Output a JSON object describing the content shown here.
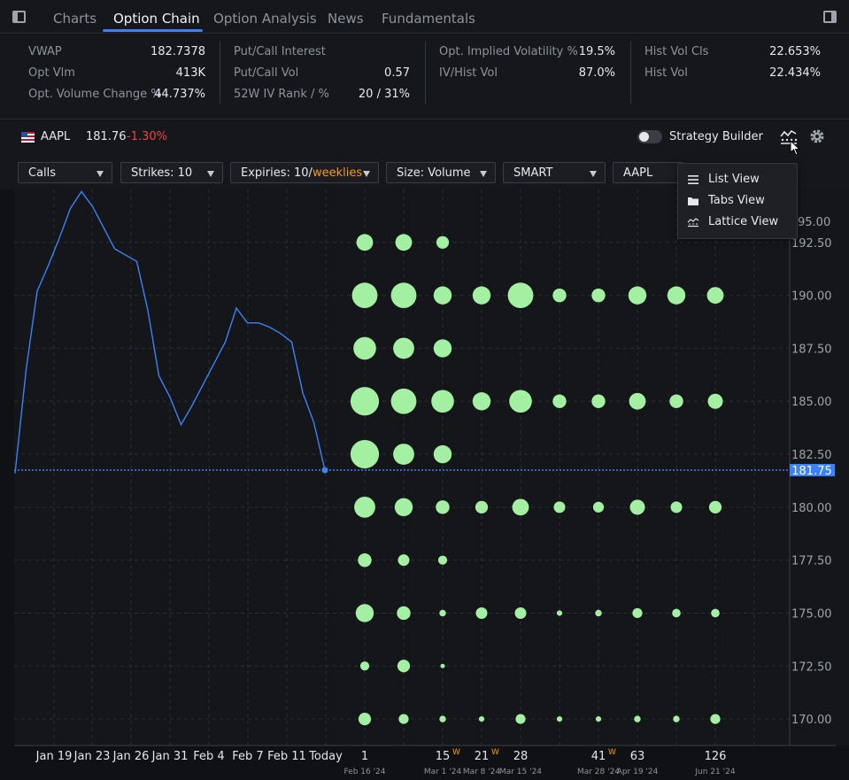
{
  "tabs": [
    {
      "label": "Charts"
    },
    {
      "label": "Option Chain"
    },
    {
      "label": "Option Analysis"
    },
    {
      "label": "News"
    },
    {
      "label": "Fundamentals"
    }
  ],
  "active_tab": "Option Chain",
  "stats": [
    [
      {
        "label": "VWAP",
        "value": "182.7378"
      },
      {
        "label": "Opt Vlm",
        "value": "413K"
      },
      {
        "label": "Opt. Volume Change %",
        "value": "44.737%"
      }
    ],
    [
      {
        "label": "Put/Call Interest",
        "value": ""
      },
      {
        "label": "Put/Call Vol",
        "value": "0.57"
      },
      {
        "label": "52W IV Rank / %",
        "value": "20 / 31%"
      }
    ],
    [
      {
        "label": "Opt. Implied Volatility %",
        "value": "19.5%"
      },
      {
        "label": "IV/Hist Vol",
        "value": "87.0%"
      }
    ],
    [
      {
        "label": "Hist Vol Cls",
        "value": "22.653%"
      },
      {
        "label": "Hist Vol",
        "value": "22.434%"
      }
    ]
  ],
  "ticker": {
    "symbol": "AAPL",
    "price": "181.76",
    "change": "-1.30%"
  },
  "strategy_builder": {
    "label": "Strategy Builder",
    "enabled": false
  },
  "filters": {
    "calls": "Calls",
    "strikes": "Strikes: 10",
    "expiries_prefix": "Expiries: 10/",
    "expiries_weekly": "weeklies",
    "size": "Size: Volume",
    "exchange": "SMART",
    "underlying": "AAPL"
  },
  "view_menu": [
    {
      "label": "List View",
      "icon": "list-icon"
    },
    {
      "label": "Tabs View",
      "icon": "folder-icon"
    },
    {
      "label": "Lattice View",
      "icon": "lattice-icon"
    }
  ],
  "colors": {
    "bubble": "#a3f0a3",
    "price_line": "#3b82f6",
    "negative": "#ef4444",
    "weekly": "#f59e0b",
    "accent": "#3b82f6"
  },
  "chart_data": {
    "type": "scatter",
    "current_price": 181.75,
    "current_price_label": "181.75",
    "strike_ticks": [
      "192.50",
      "190.00",
      "187.50",
      "185.00",
      "182.50",
      "180.00",
      "177.50",
      "175.00",
      "172.50",
      "170.00"
    ],
    "top_tick_partial": "95.00",
    "strikes": [
      192.5,
      190,
      187.5,
      185,
      182.5,
      180,
      177.5,
      175,
      172.5,
      170
    ],
    "ylim": [
      168.75,
      195
    ],
    "history_dates": [
      "Jan 19",
      "Jan 23",
      "Jan 26",
      "Jan 31",
      "Feb 4",
      "Feb 7",
      "Feb 11",
      "Today"
    ],
    "price_history": [
      181.6,
      186.5,
      190.2,
      191.4,
      192.7,
      194.1,
      194.9,
      194.2,
      193.2,
      192.2,
      191.9,
      191.6,
      189.3,
      186.2,
      185.2,
      183.9,
      184.8,
      185.8,
      186.8,
      187.8,
      189.4,
      188.7,
      188.7,
      188.5,
      188.2,
      187.8,
      185.4,
      184,
      181.75
    ],
    "expiries": [
      {
        "label": "1",
        "date": "Feb 16 '24",
        "weekly": false
      },
      {
        "label": "",
        "date": "",
        "weekly": false
      },
      {
        "label": "15",
        "date": "Mar 1 '24",
        "weekly": true
      },
      {
        "label": "21",
        "date": "Mar 8 '24",
        "weekly": true
      },
      {
        "label": "28",
        "date": "Mar 15 '24",
        "weekly": false
      },
      {
        "label": "",
        "date": "",
        "weekly": false
      },
      {
        "label": "41",
        "date": "Mar 28 '24",
        "weekly": true
      },
      {
        "label": "63",
        "date": "Apr 19 '24",
        "weekly": false
      },
      {
        "label": "",
        "date": "",
        "weekly": false
      },
      {
        "label": "126",
        "date": "Jun 21 '24",
        "weekly": false
      }
    ],
    "weekly_marker": "W",
    "volume_size": [
      [
        0.55,
        0.55,
        0.42,
        0,
        0,
        0,
        0,
        0,
        0,
        0
      ],
      [
        0.85,
        0.85,
        0.6,
        0.6,
        0.85,
        0.45,
        0.45,
        0.6,
        0.6,
        0.55
      ],
      [
        0.75,
        0.7,
        0.6,
        0,
        0,
        0,
        0,
        0,
        0,
        0
      ],
      [
        0.95,
        0.85,
        0.75,
        0.6,
        0.75,
        0.45,
        0.45,
        0.55,
        0.45,
        0.5
      ],
      [
        0.95,
        0.7,
        0.6,
        0,
        0,
        0,
        0,
        0,
        0,
        0
      ],
      [
        0.7,
        0.6,
        0.45,
        0.42,
        0.55,
        0.38,
        0.36,
        0.5,
        0.38,
        0.42
      ],
      [
        0.45,
        0.38,
        0.3,
        0,
        0,
        0,
        0,
        0,
        0,
        0
      ],
      [
        0.6,
        0.45,
        0.22,
        0.38,
        0.38,
        0.18,
        0.22,
        0.33,
        0.28,
        0.28
      ],
      [
        0.3,
        0.42,
        0.15,
        0,
        0,
        0,
        0,
        0,
        0,
        0
      ],
      [
        0.42,
        0.33,
        0.22,
        0.18,
        0.33,
        0.18,
        0.18,
        0.22,
        0.22,
        0.33
      ]
    ]
  }
}
